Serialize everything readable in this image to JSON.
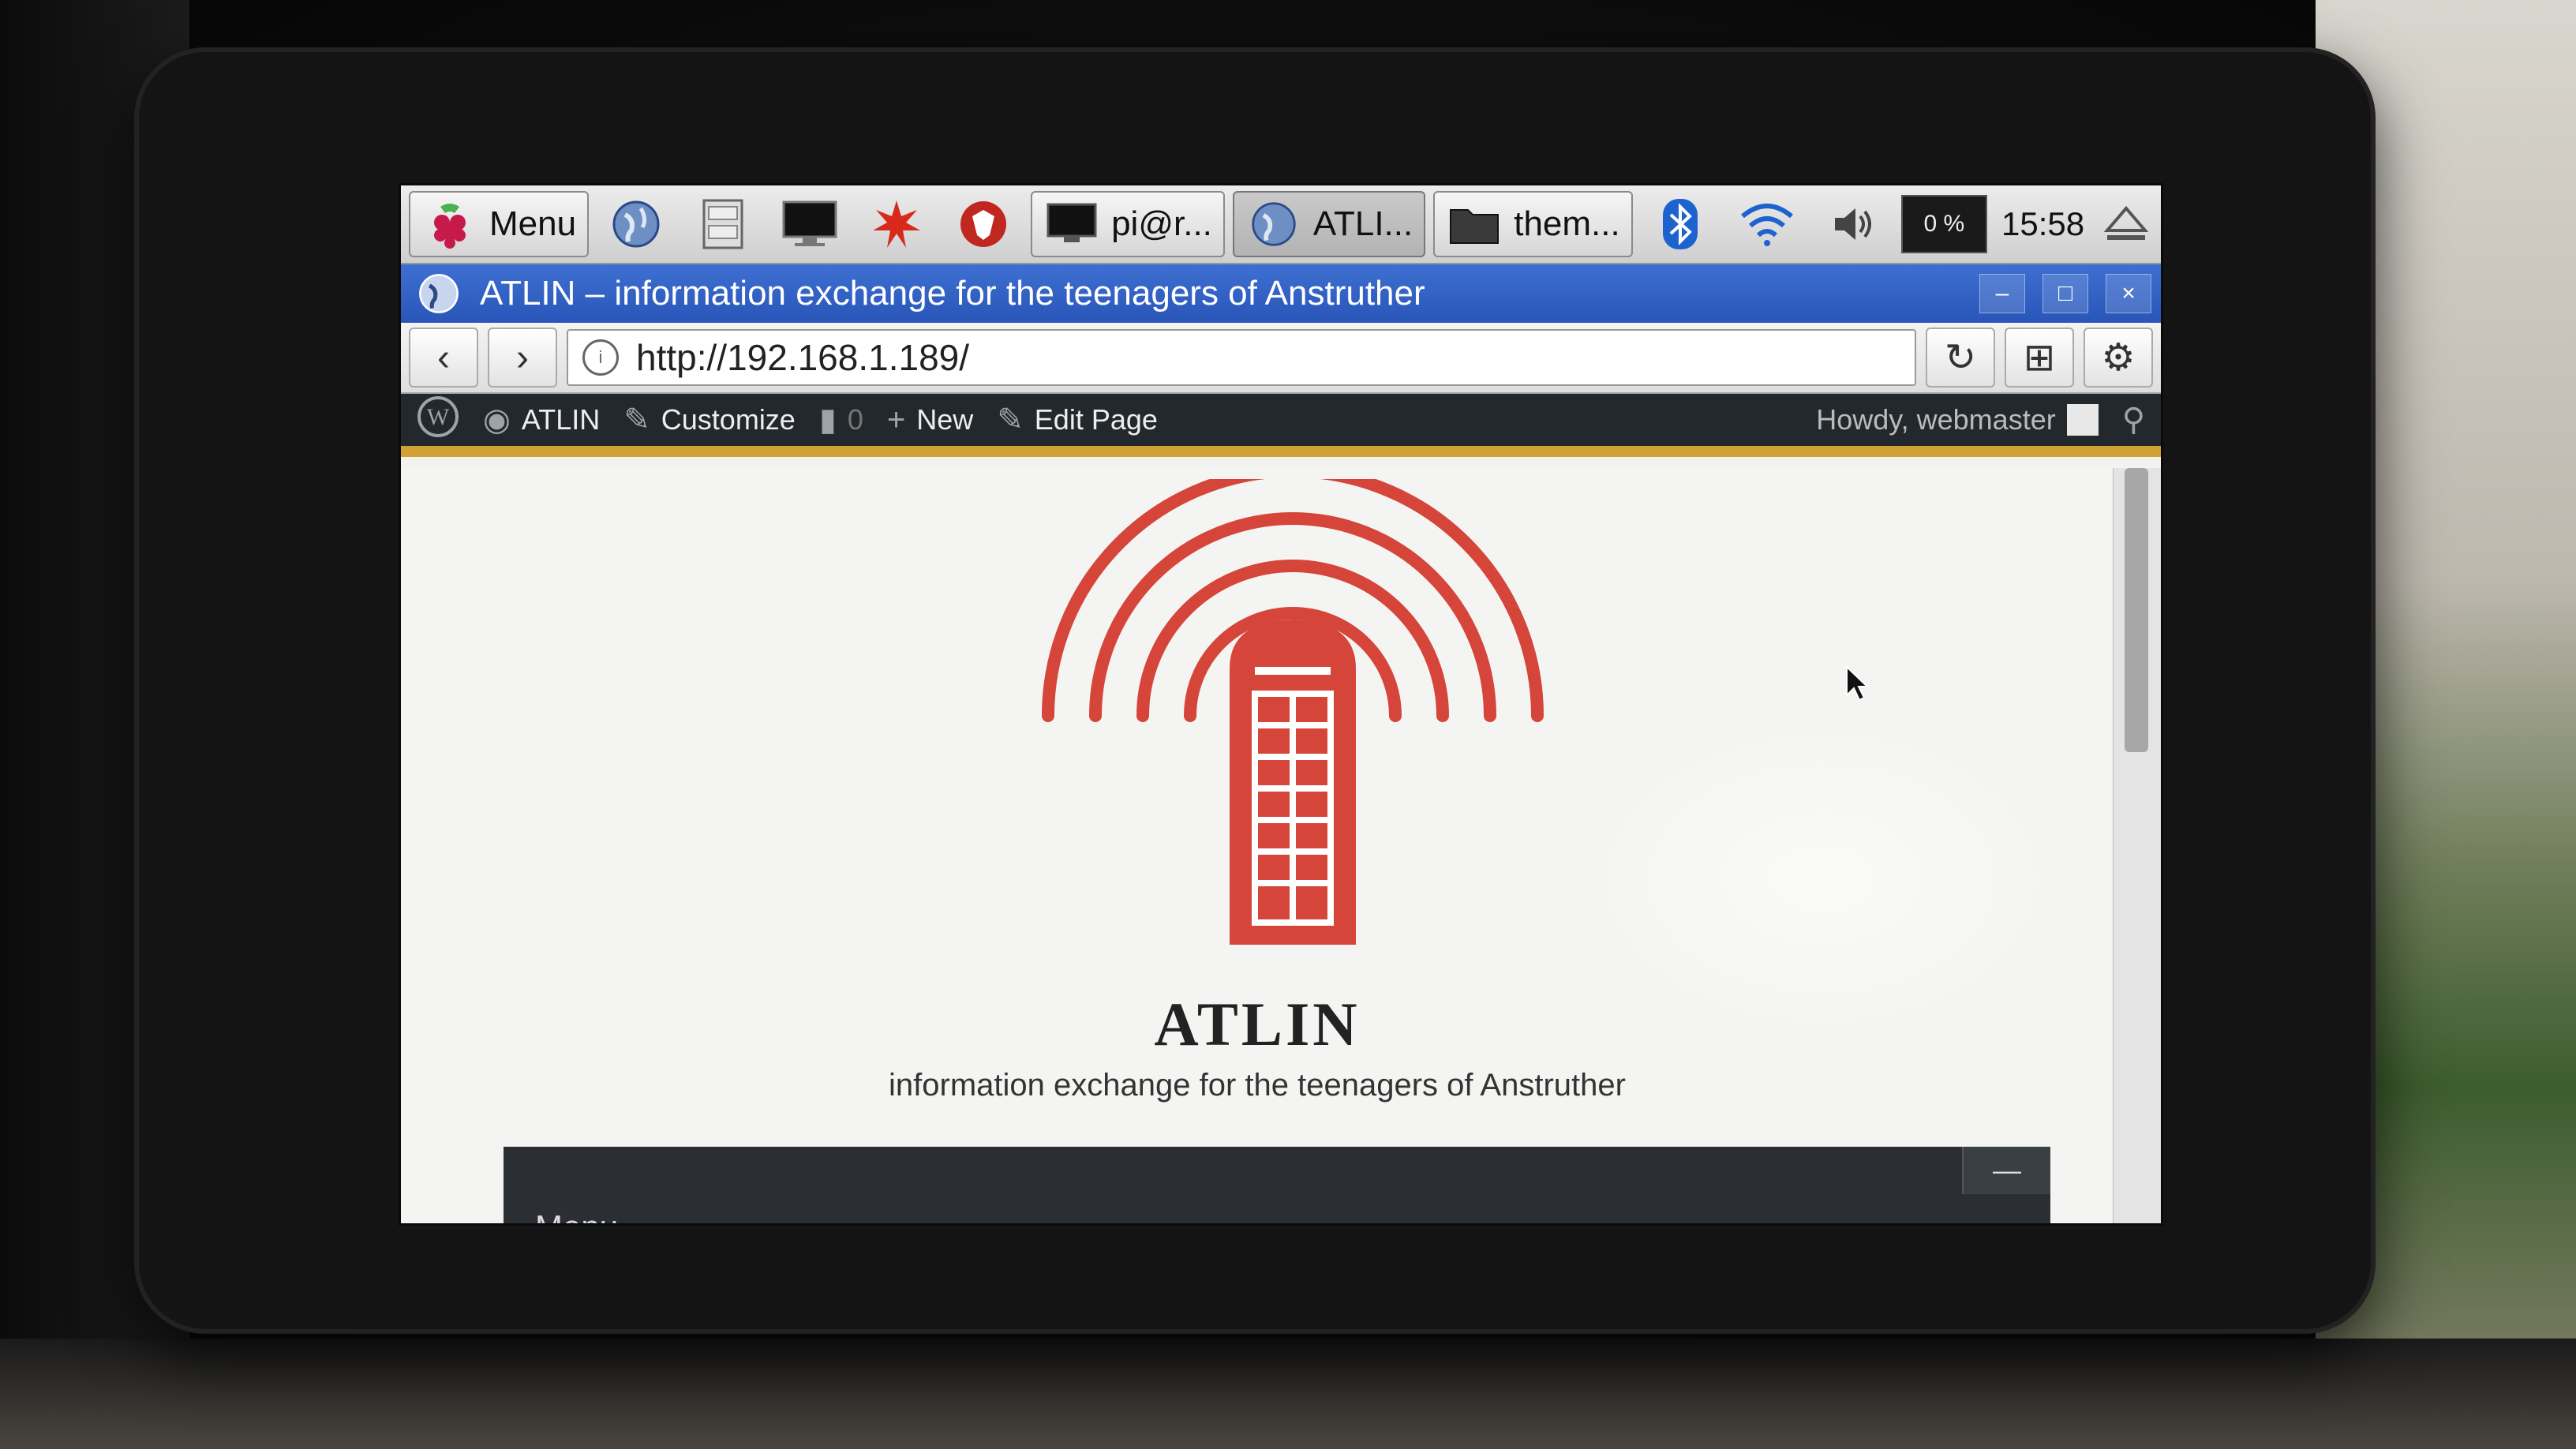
{
  "taskbar": {
    "menu_label": "Menu",
    "launchers": [
      "web-browser",
      "file-manager",
      "terminal",
      "mathematica",
      "wolfram"
    ],
    "tasks": [
      {
        "label": "pi@r...",
        "icon": "terminal-icon"
      },
      {
        "label": "ATLI...",
        "icon": "globe-icon"
      },
      {
        "label": "them...",
        "icon": "folder-icon"
      }
    ],
    "cpu": "0 %",
    "clock": "15:58"
  },
  "window": {
    "title": "ATLIN – information exchange for the teenagers of Anstruther",
    "min": "–",
    "max": "□",
    "close": "×"
  },
  "browser": {
    "url": "http://192.168.1.189/"
  },
  "adminbar": {
    "site": "ATLIN",
    "customize": "Customize",
    "comments": "0",
    "new": "New",
    "edit": "Edit Page",
    "howdy": "Howdy, webmaster"
  },
  "site": {
    "title": "ATLIN",
    "description": "information exchange for the teenagers of Anstruther",
    "menu_label": "Menu",
    "menu_toggle": "—"
  },
  "colors": {
    "logo_red": "#d6453a",
    "admin_bar": "#23282d",
    "accent_gold": "#d1a233",
    "titlebar_blue": "#2f5fc4"
  }
}
